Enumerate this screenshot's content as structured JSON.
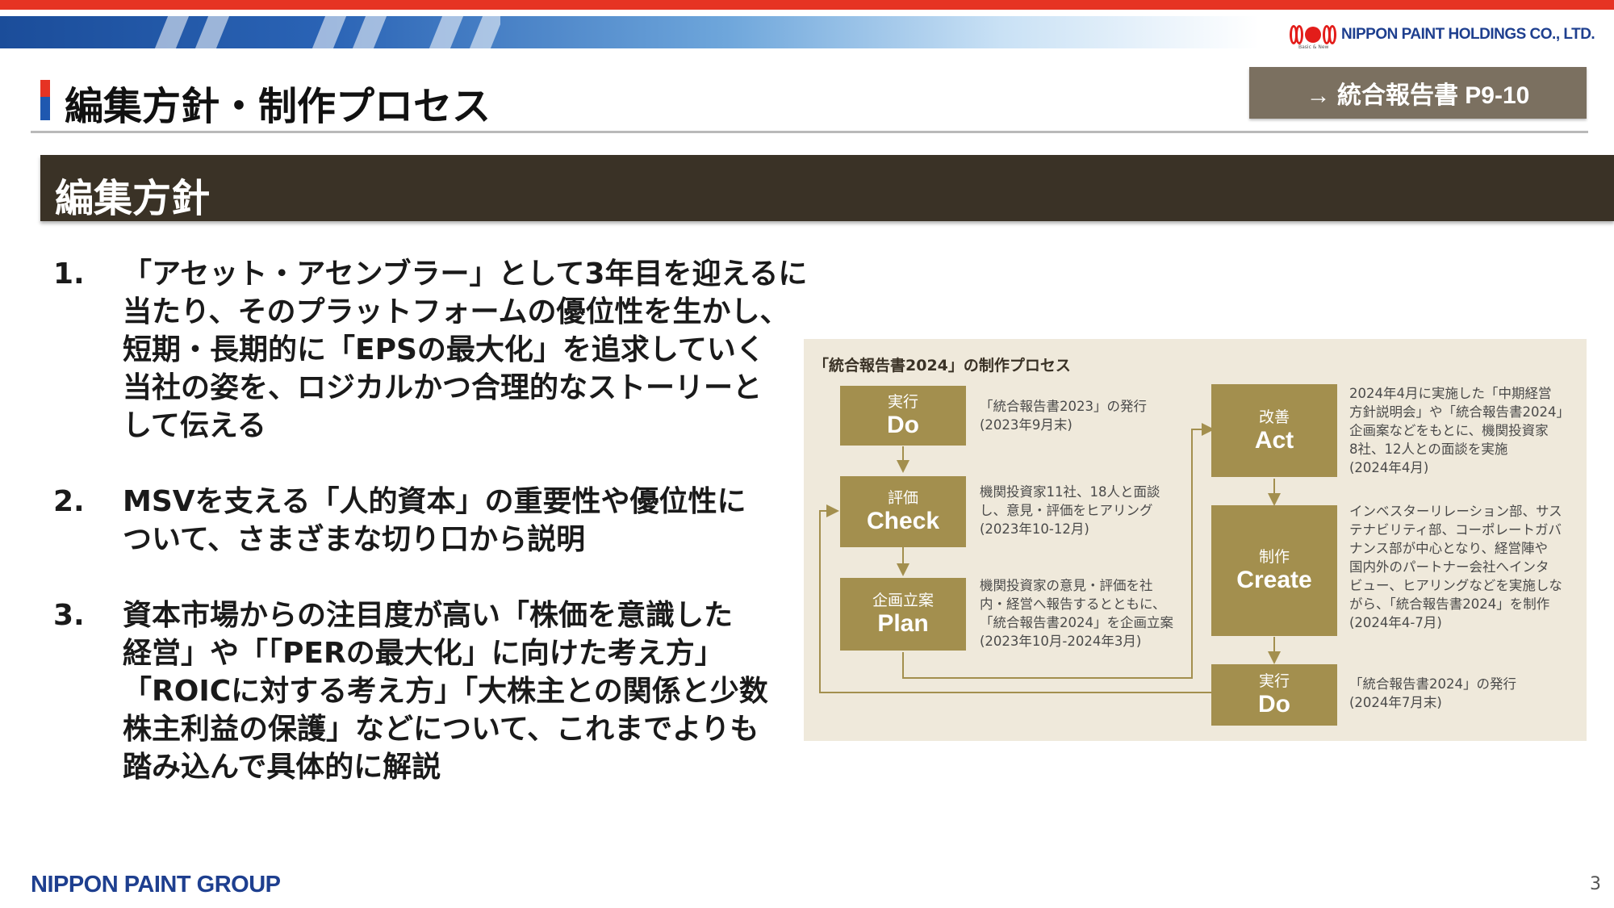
{
  "header": {
    "company_logo": "NIPPON PAINT HOLDINGS CO., LTD.",
    "logo_tagline": "Basic & New",
    "page_title": "編集方針・制作プロセス",
    "reference_button": "→ 統合報告書 P9-10"
  },
  "section": {
    "heading": "編集方針"
  },
  "policies": [
    {
      "number": "1.",
      "lines": [
        "「アセット・アセンブラー」として3年目を迎えるに",
        "当たり、そのプラットフォームの優位性を生かし、",
        "短期・長期的に「EPSの最大化」を追求していく",
        "当社の姿を、ロジカルかつ合理的なストーリーと",
        "して伝える"
      ]
    },
    {
      "number": "2.",
      "lines": [
        "MSVを支える「人的資本」の重要性や優位性に",
        "ついて、さまざまな切り口から説明"
      ]
    },
    {
      "number": "3.",
      "lines": [
        "資本市場からの注目度が高い「株価を意識した",
        "経営」や「「PERの最大化」に向けた考え方」",
        "「ROICに対する考え方」「大株主との関係と少数",
        "株主利益の保護」などについて、これまでよりも",
        "踏み込んで具体的に解説"
      ]
    }
  ],
  "process_diagram": {
    "title": "「統合報告書2024」の制作プロセス",
    "steps": [
      {
        "jp": "実行",
        "en": "Do",
        "note": [
          "「統合報告書2023」の発行",
          "(2023年9月末)"
        ]
      },
      {
        "jp": "評価",
        "en": "Check",
        "note": [
          "機関投資家11社、18人と面談",
          "し、意見・評価をヒアリング",
          "(2023年10-12月)"
        ]
      },
      {
        "jp": "企画立案",
        "en": "Plan",
        "note": [
          "機関投資家の意見・評価を社",
          "内・経営へ報告するとともに、",
          "「統合報告書2024」を企画立案",
          "(2023年10月-2024年3月)"
        ]
      },
      {
        "jp": "改善",
        "en": "Act",
        "note": [
          "2024年4月に実施した「中期経営",
          "方針説明会」や「統合報告書2024」",
          "企画案などをもとに、機関投資家",
          "8社、12人との面談を実施",
          "(2024年4月)"
        ]
      },
      {
        "jp": "制作",
        "en": "Create",
        "note": [
          "インベスターリレーション部、サス",
          "テナビリティ部、コーポレートガバ",
          "ナンス部が中心となり、経営陣や",
          "国内外のパートナー会社へインタ",
          "ビュー、ヒアリングなどを実施しな",
          "がら、「統合報告書2024」を制作",
          "(2024年4-7月)"
        ]
      },
      {
        "jp": "実行",
        "en": "Do",
        "note": [
          "「統合報告書2024」の発行",
          "(2024年7月末)"
        ]
      }
    ]
  },
  "footer": {
    "group_logo": "NIPPON PAINT GROUP",
    "page_number": "3"
  },
  "colors": {
    "accent_red": "#e63323",
    "brand_blue": "#1e3f8f",
    "section_bar": "#3a3226",
    "step_box": "#a38f4e",
    "diagram_bg": "#efe9db",
    "button_bg": "#7b7060"
  }
}
